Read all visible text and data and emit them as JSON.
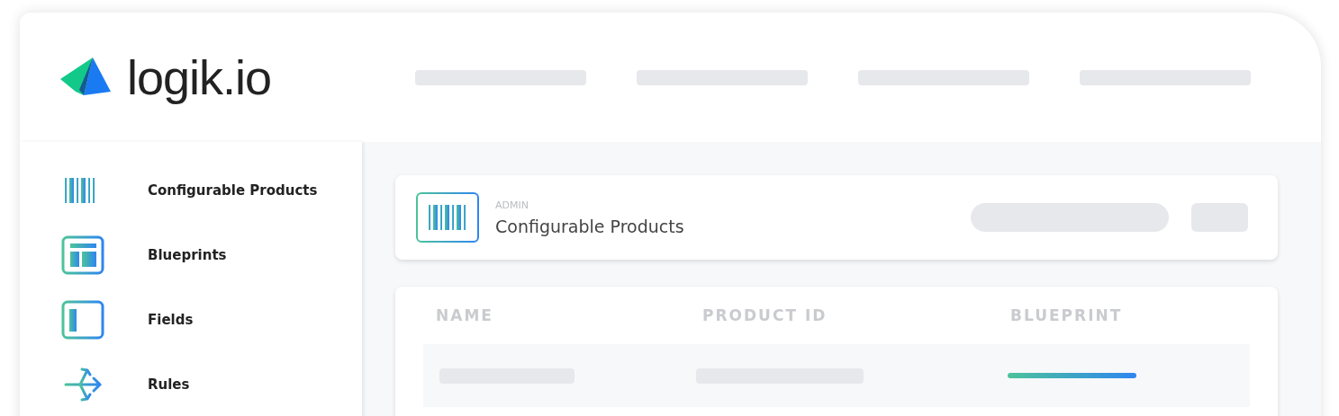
{
  "logo": {
    "text": "logik.io"
  },
  "sidebar": {
    "items": [
      {
        "label": "Configurable Products",
        "kind": "barcode"
      },
      {
        "label": "Blueprints",
        "kind": "layout"
      },
      {
        "label": "Fields",
        "kind": "panel"
      },
      {
        "label": "Rules",
        "kind": "arrows"
      }
    ]
  },
  "page_header": {
    "eyebrow": "ADMIN",
    "title": "Configurable Products"
  },
  "table": {
    "columns": [
      "NAME",
      "PRODUCT ID",
      "BLUEPRINT"
    ]
  }
}
